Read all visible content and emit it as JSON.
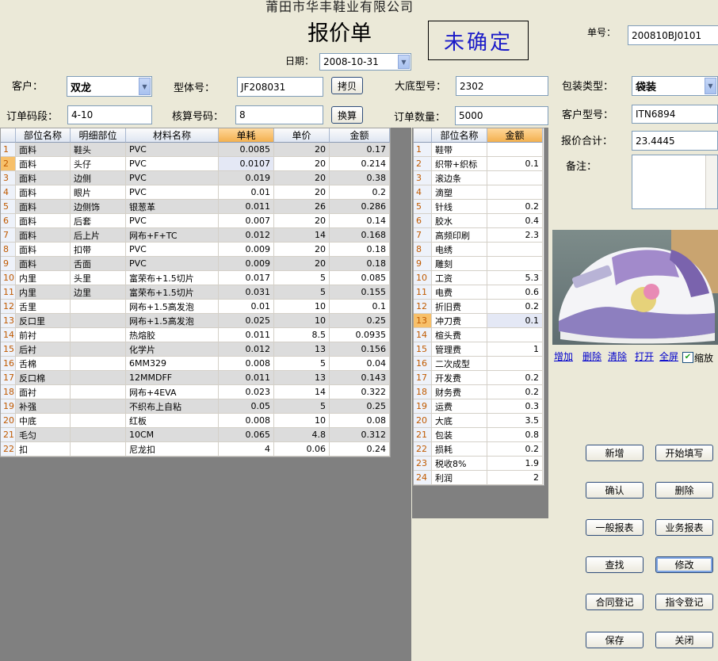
{
  "header": {
    "company": "莆田市华丰鞋业有限公司",
    "title": "报价单",
    "status_stamp": "未确定",
    "date_label": "日期：",
    "date_value": "2008-10-31",
    "order_no_label": "单号：",
    "order_no_value": "200810BJ0101"
  },
  "form": {
    "customer_label": "客户：",
    "customer_value": "双龙",
    "model_label": "型体号：",
    "model_value": "JF208031",
    "copy_button": "拷贝",
    "sole_label": "大底型号：",
    "sole_value": "2302",
    "pack_label": "包装类型：",
    "pack_value": "袋装",
    "size_range_label": "订单码段：",
    "size_range_value": "4-10",
    "calc_size_label": "核算号码：",
    "calc_size_value": "8",
    "convert_button": "换算",
    "qty_label": "订单数量：",
    "qty_value": "5000",
    "cust_model_label": "客户型号：",
    "cust_model_value": "ITN6894",
    "total_label": "报价合计：",
    "total_value": "23.4445",
    "remark_label": "备注：",
    "remark_value": ""
  },
  "materials": {
    "headers": [
      "部位名称",
      "明细部位",
      "材料名称",
      "单耗",
      "单价",
      "金额"
    ],
    "rows": [
      {
        "n": "1",
        "a": "面料",
        "b": "鞋头",
        "c": "PVC",
        "d": "0.0085",
        "e": "20",
        "f": "0.17"
      },
      {
        "n": "2",
        "a": "面料",
        "b": "头仔",
        "c": "PVC",
        "d": "0.0107",
        "e": "20",
        "f": "0.214"
      },
      {
        "n": "3",
        "a": "面料",
        "b": "边侧",
        "c": "PVC",
        "d": "0.019",
        "e": "20",
        "f": "0.38"
      },
      {
        "n": "4",
        "a": "面料",
        "b": "眼片",
        "c": "PVC",
        "d": "0.01",
        "e": "20",
        "f": "0.2"
      },
      {
        "n": "5",
        "a": "面料",
        "b": "边侧饰",
        "c": "银葱革",
        "d": "0.011",
        "e": "26",
        "f": "0.286"
      },
      {
        "n": "6",
        "a": "面料",
        "b": "后套",
        "c": "PVC",
        "d": "0.007",
        "e": "20",
        "f": "0.14"
      },
      {
        "n": "7",
        "a": "面料",
        "b": "后上片",
        "c": "网布+F+TC",
        "d": "0.012",
        "e": "14",
        "f": "0.168"
      },
      {
        "n": "8",
        "a": "面料",
        "b": "扣带",
        "c": "PVC",
        "d": "0.009",
        "e": "20",
        "f": "0.18"
      },
      {
        "n": "9",
        "a": "面料",
        "b": "舌面",
        "c": "PVC",
        "d": "0.009",
        "e": "20",
        "f": "0.18"
      },
      {
        "n": "10",
        "a": "内里",
        "b": "头里",
        "c": "富荣布+1.5切片",
        "d": "0.017",
        "e": "5",
        "f": "0.085"
      },
      {
        "n": "11",
        "a": "内里",
        "b": "边里",
        "c": "富荣布+1.5切片",
        "d": "0.031",
        "e": "5",
        "f": "0.155"
      },
      {
        "n": "12",
        "a": "舌里",
        "b": "",
        "c": "网布+1.5高发泡",
        "d": "0.01",
        "e": "10",
        "f": "0.1"
      },
      {
        "n": "13",
        "a": "反口里",
        "b": "",
        "c": "网布+1.5高发泡",
        "d": "0.025",
        "e": "10",
        "f": "0.25"
      },
      {
        "n": "14",
        "a": "前衬",
        "b": "",
        "c": "热熔胶",
        "d": "0.011",
        "e": "8.5",
        "f": "0.0935"
      },
      {
        "n": "15",
        "a": "后衬",
        "b": "",
        "c": "化学片",
        "d": "0.012",
        "e": "13",
        "f": "0.156"
      },
      {
        "n": "16",
        "a": "舌棉",
        "b": "",
        "c": "6MM329",
        "d": "0.008",
        "e": "5",
        "f": "0.04"
      },
      {
        "n": "17",
        "a": "反口棉",
        "b": "",
        "c": "12MMDFF",
        "d": "0.011",
        "e": "13",
        "f": "0.143"
      },
      {
        "n": "18",
        "a": "面衬",
        "b": "",
        "c": "网布+4EVA",
        "d": "0.023",
        "e": "14",
        "f": "0.322"
      },
      {
        "n": "19",
        "a": "补强",
        "b": "",
        "c": "不织布上自粘",
        "d": "0.05",
        "e": "5",
        "f": "0.25"
      },
      {
        "n": "20",
        "a": "中底",
        "b": "",
        "c": "红板",
        "d": "0.008",
        "e": "10",
        "f": "0.08"
      },
      {
        "n": "21",
        "a": "毛匀",
        "b": "",
        "c": "10CM",
        "d": "0.065",
        "e": "4.8",
        "f": "0.312"
      },
      {
        "n": "22",
        "a": "扣",
        "b": "",
        "c": "尼龙扣",
        "d": "4",
        "e": "0.06",
        "f": "0.24"
      }
    ]
  },
  "costs": {
    "headers": [
      "部位名称",
      "金额"
    ],
    "rows": [
      {
        "n": "1",
        "a": "鞋带",
        "f": ""
      },
      {
        "n": "2",
        "a": "织带+织标",
        "f": "0.1"
      },
      {
        "n": "3",
        "a": "滚边条",
        "f": ""
      },
      {
        "n": "4",
        "a": "滴塑",
        "f": ""
      },
      {
        "n": "5",
        "a": "针线",
        "f": "0.2"
      },
      {
        "n": "6",
        "a": "胶水",
        "f": "0.4"
      },
      {
        "n": "7",
        "a": "高频印刷",
        "f": "2.3"
      },
      {
        "n": "8",
        "a": "电绣",
        "f": ""
      },
      {
        "n": "9",
        "a": "雕刻",
        "f": ""
      },
      {
        "n": "10",
        "a": "工资",
        "f": "5.3"
      },
      {
        "n": "11",
        "a": "电费",
        "f": "0.6"
      },
      {
        "n": "12",
        "a": "折旧费",
        "f": "0.2"
      },
      {
        "n": "13",
        "a": "冲刀费",
        "f": "0.1"
      },
      {
        "n": "14",
        "a": "楦头费",
        "f": ""
      },
      {
        "n": "15",
        "a": "管理费",
        "f": "1"
      },
      {
        "n": "16",
        "a": "二次成型",
        "f": ""
      },
      {
        "n": "17",
        "a": "开发费",
        "f": "0.2"
      },
      {
        "n": "18",
        "a": "财务费",
        "f": "0.2"
      },
      {
        "n": "19",
        "a": "运费",
        "f": "0.3"
      },
      {
        "n": "20",
        "a": "大底",
        "f": "3.5"
      },
      {
        "n": "21",
        "a": "包装",
        "f": "0.8"
      },
      {
        "n": "22",
        "a": "损耗",
        "f": "0.2"
      },
      {
        "n": "23",
        "a": "税收8%",
        "f": "1.9"
      },
      {
        "n": "24",
        "a": "利润",
        "f": "2"
      }
    ]
  },
  "image_links": {
    "add": "增加",
    "delete": "删除",
    "clear": "清除",
    "open": "打开",
    "fullscreen": "全屏",
    "zoom": "缩放"
  },
  "buttons": {
    "new": "新增",
    "start_fill": "开始填写",
    "confirm": "确认",
    "delete": "删除",
    "general_report": "一般报表",
    "business_report": "业务报表",
    "find": "查找",
    "modify": "修改",
    "contract_reg": "合同登记",
    "instruction_reg": "指令登记",
    "save": "保存",
    "close": "关闭"
  }
}
